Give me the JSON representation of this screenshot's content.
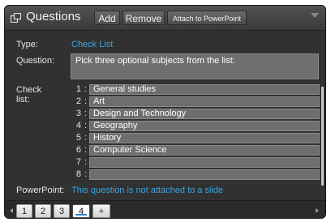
{
  "header": {
    "title": "Questions",
    "buttons": {
      "add": "Add",
      "remove": "Remove",
      "attach": "Attach to PowerPoint"
    }
  },
  "type": {
    "label": "Type:",
    "value": "Check List"
  },
  "question": {
    "label": "Question:",
    "value": "Pick three optional subjects from the list:"
  },
  "checklist": {
    "label_line1": "Check",
    "label_line2": "list:",
    "items": [
      {
        "num": "1",
        "text": "General studies"
      },
      {
        "num": "2",
        "text": "Art"
      },
      {
        "num": "3",
        "text": "Design and Technology"
      },
      {
        "num": "4",
        "text": "Geography"
      },
      {
        "num": "5",
        "text": "History"
      },
      {
        "num": "6",
        "text": "Computer Science"
      },
      {
        "num": "7",
        "text": ""
      },
      {
        "num": "8",
        "text": ""
      }
    ]
  },
  "powerpoint": {
    "label": "PowerPoint:",
    "value": "This question is not attached to a slide"
  },
  "tabs": {
    "items": [
      "1",
      "2",
      "3",
      "4",
      "+"
    ],
    "active": "4"
  }
}
